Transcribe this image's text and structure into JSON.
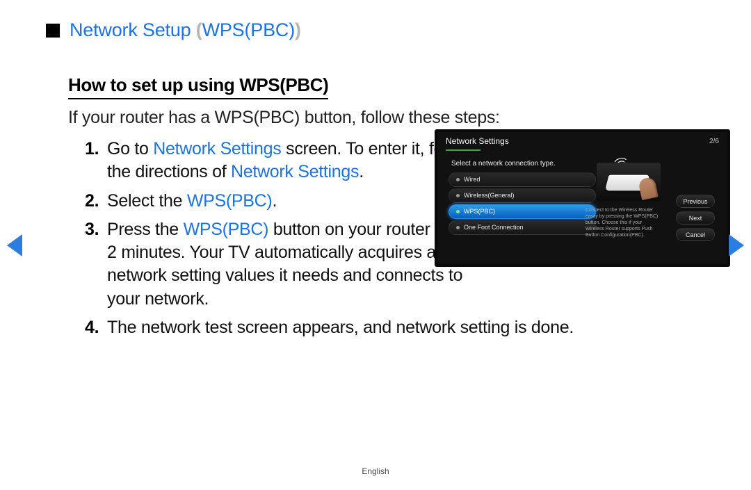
{
  "title": {
    "pre": "Network Setup ",
    "paren_open": "(",
    "mode": "WPS(PBC)",
    "paren_close": ")"
  },
  "subtitle": "How to set up using WPS(PBC)",
  "intro": "If your router has a WPS(PBC) button, follow these steps:",
  "steps": {
    "s1": {
      "t1": "Go to ",
      "link1": "Network Settings",
      "t2": " screen. To enter it, follow the directions of ",
      "link2": "Network Settings",
      "t3": "."
    },
    "s2": {
      "t1": "Select the ",
      "link1": "WPS(PBC)",
      "t2": "."
    },
    "s3": {
      "t1": "Press the ",
      "link1": "WPS(PBC)",
      "t2": " button on your router within 2 minutes. Your TV automatically acquires all the network setting values it needs and connects to your network."
    },
    "s4": {
      "t1": "The network test screen appears, and network setting is done."
    }
  },
  "panel": {
    "title": "Network Settings",
    "pager": "2/6",
    "subtitle": "Select a network connection type.",
    "options": {
      "o1": "Wired",
      "o2": "Wireless(General)",
      "o3": "WPS(PBC)",
      "o4": "One Foot Connection"
    },
    "desc": "Connect to the Wireless Router easily by pressing the WPS(PBC) button. Choose this if your Wireless Router supports Push Button Configuration(PBC).",
    "buttons": {
      "prev": "Previous",
      "next": "Next",
      "cancel": "Cancel"
    }
  },
  "lang": "English"
}
